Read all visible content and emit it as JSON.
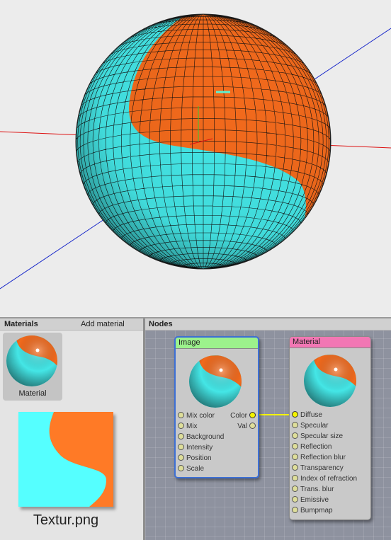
{
  "colors": {
    "sphere_cyan": "#44e6e6",
    "sphere_orange": "#f36a1c",
    "texture_cyan": "#55ffff",
    "texture_orange": "#ff7a26",
    "image_node_header": "#9cf28c",
    "material_node_header": "#f277b4",
    "selection_blue": "#3d6fd4",
    "link_yellow": "#f4f400"
  },
  "materials_panel": {
    "title": "Materials",
    "add_label": "Add material",
    "items": [
      {
        "label": "Material"
      }
    ],
    "texture_name": "Textur.png"
  },
  "nodes_panel": {
    "title": "Nodes",
    "image_node": {
      "title": "Image",
      "inputs": [
        "Mix color",
        "Mix",
        "Background",
        "Intensity",
        "Position",
        "Scale"
      ],
      "outputs": [
        "Color",
        "Val"
      ]
    },
    "material_node": {
      "title": "Material",
      "inputs": [
        "Diffuse",
        "Specular",
        "Specular size",
        "Reflection",
        "Reflection blur",
        "Transparency",
        "Index of refraction",
        "Trans. blur",
        "Emissive",
        "Bumpmap"
      ]
    }
  }
}
